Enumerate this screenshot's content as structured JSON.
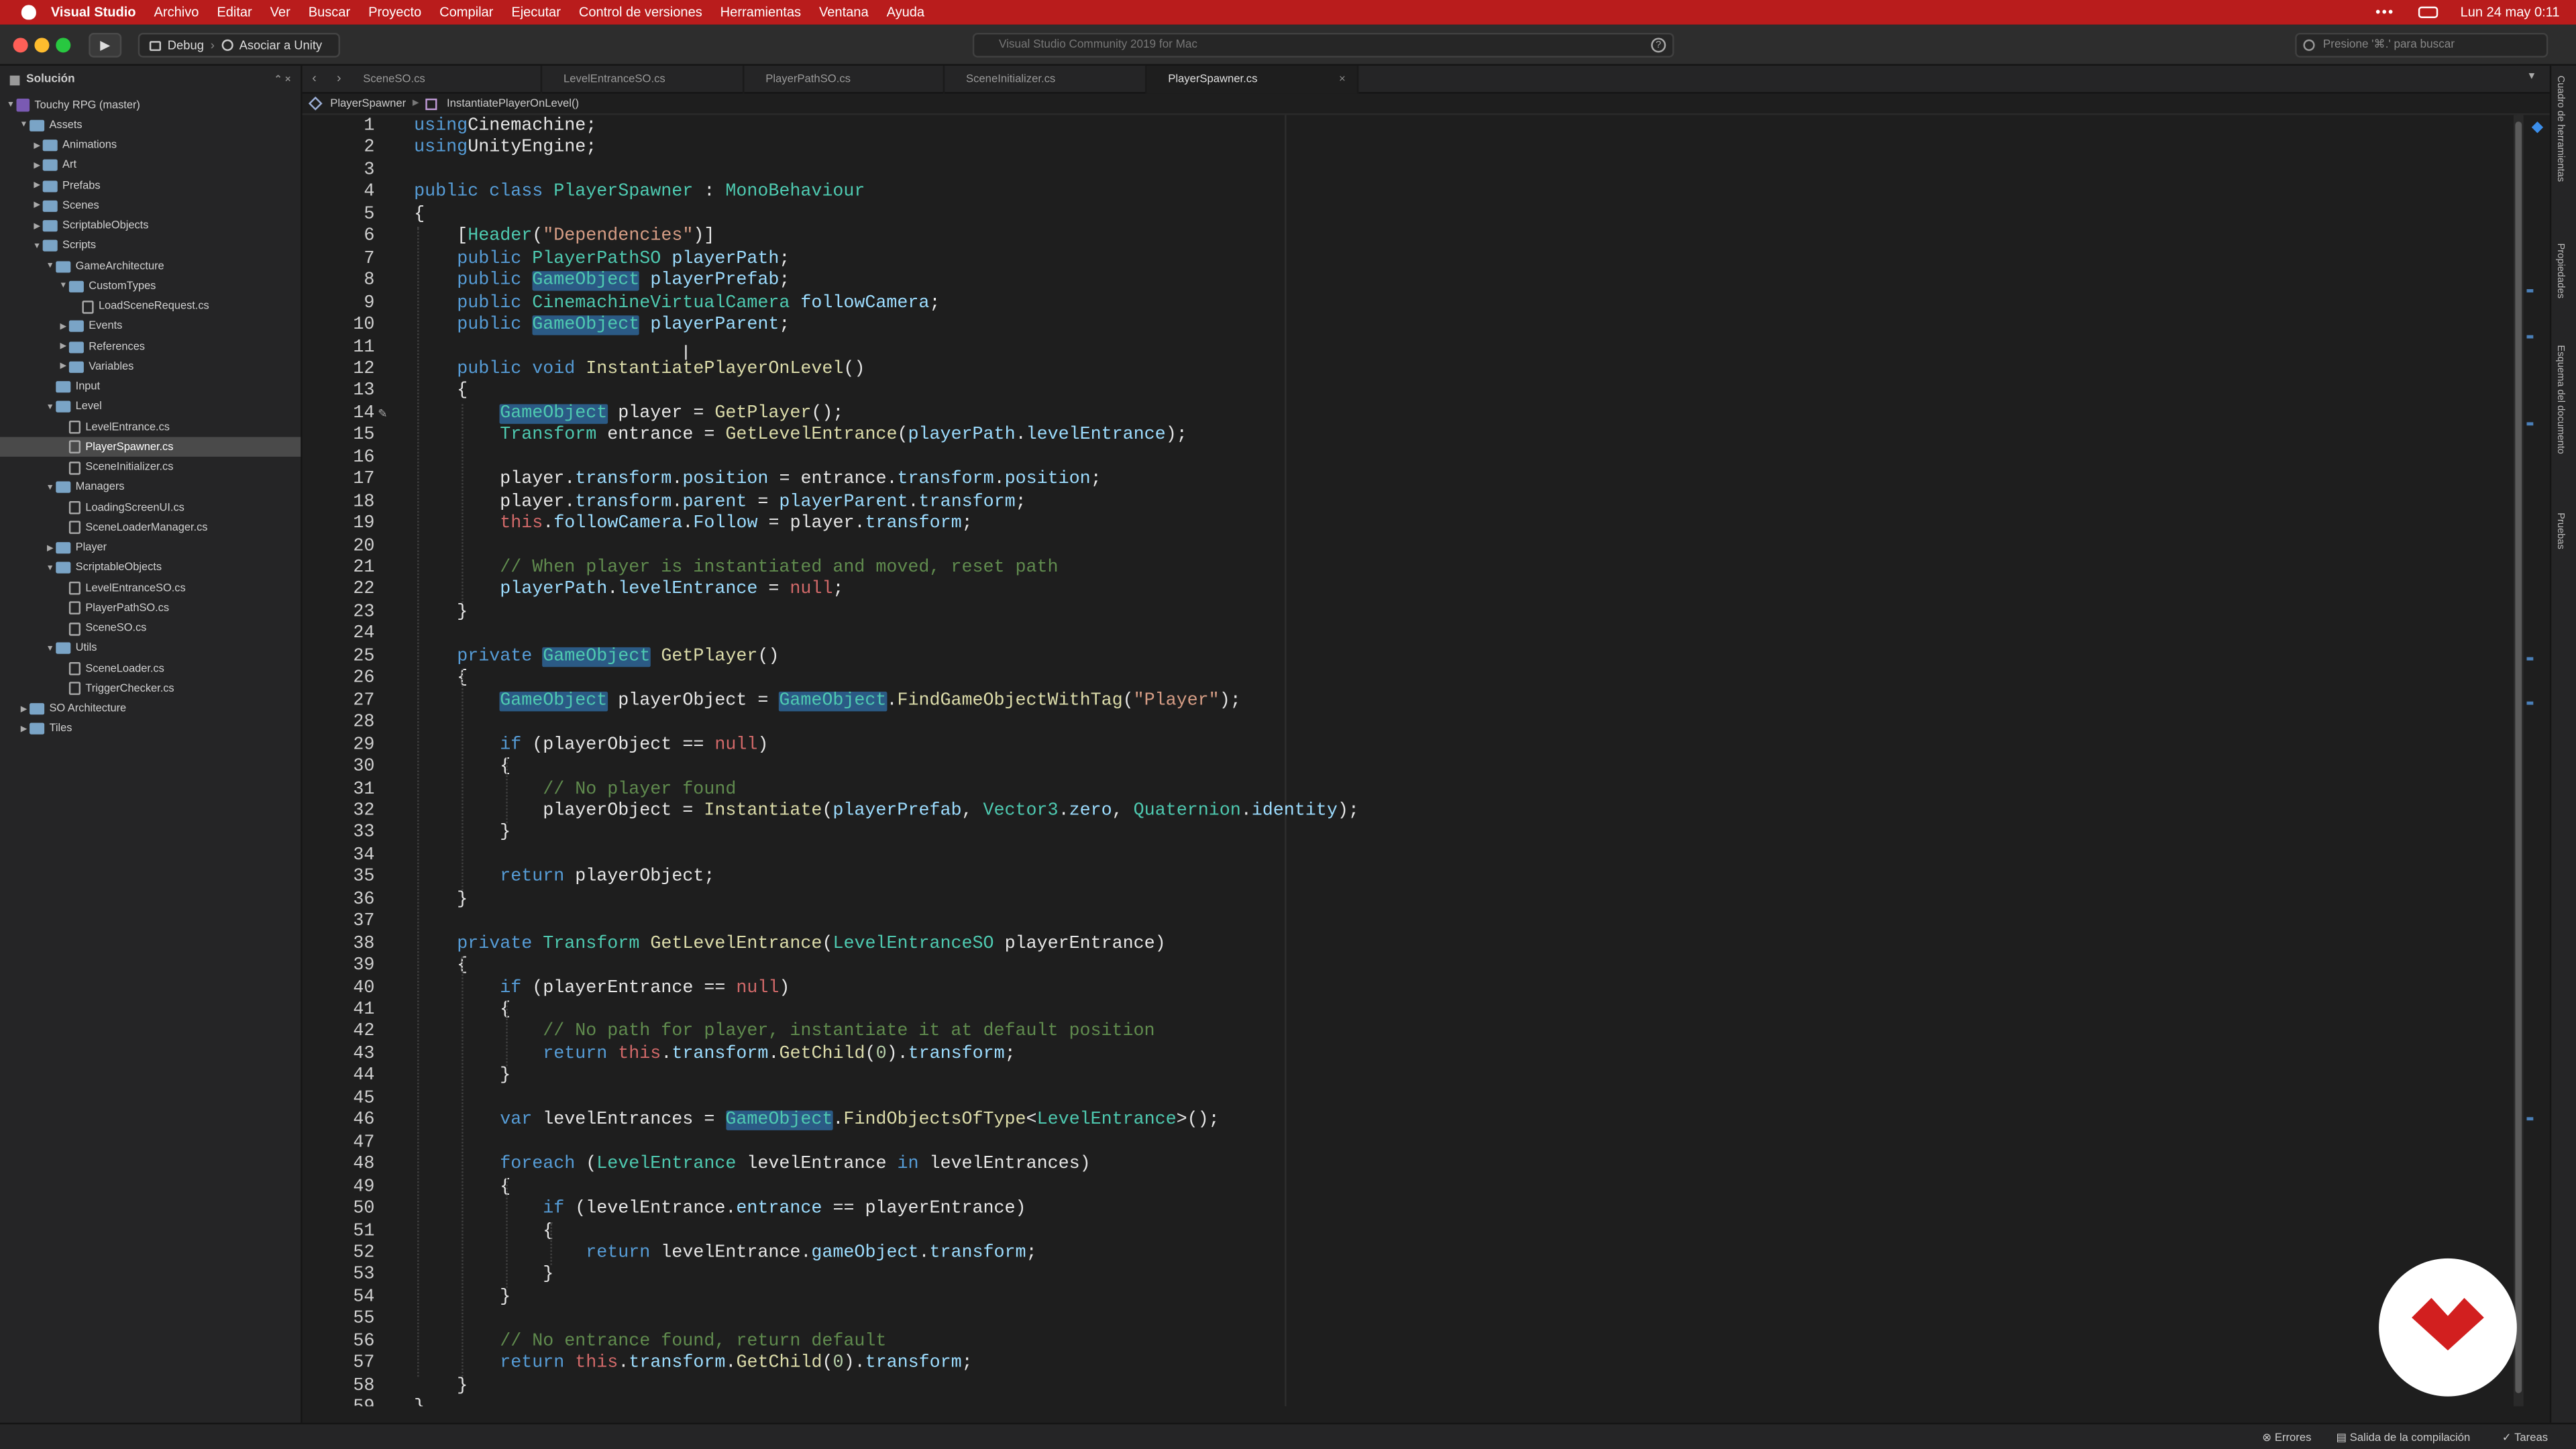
{
  "menubar": {
    "app": "Visual Studio",
    "items": [
      "Archivo",
      "Editar",
      "Ver",
      "Buscar",
      "Proyecto",
      "Compilar",
      "Ejecutar",
      "Control de versiones",
      "Herramientas",
      "Ventana",
      "Ayuda"
    ],
    "more": "•••",
    "clock": "Lun 24 may  0:11"
  },
  "toolbar": {
    "config": "Debug",
    "target": "Asociar a Unity",
    "status": "Visual Studio Community 2019 for Mac",
    "search_placeholder": "Presione '⌘.' para buscar"
  },
  "sidebar": {
    "title": "Solución",
    "rows": [
      {
        "label": "Touchy RPG (master)",
        "depth": 0,
        "icon": "sol",
        "open": true
      },
      {
        "label": "Assets",
        "depth": 1,
        "icon": "folder",
        "open": true
      },
      {
        "label": "Animations",
        "depth": 2,
        "icon": "folder",
        "open": false
      },
      {
        "label": "Art",
        "depth": 2,
        "icon": "folder",
        "open": false
      },
      {
        "label": "Prefabs",
        "depth": 2,
        "icon": "folder",
        "open": false
      },
      {
        "label": "Scenes",
        "depth": 2,
        "icon": "folder",
        "open": false
      },
      {
        "label": "ScriptableObjects",
        "depth": 2,
        "icon": "folder",
        "open": false
      },
      {
        "label": "Scripts",
        "depth": 2,
        "icon": "folder",
        "open": true
      },
      {
        "label": "GameArchitecture",
        "depth": 3,
        "icon": "folder",
        "open": true
      },
      {
        "label": "CustomTypes",
        "depth": 4,
        "icon": "folder",
        "open": true
      },
      {
        "label": "LoadSceneRequest.cs",
        "depth": 5,
        "icon": "file"
      },
      {
        "label": "Events",
        "depth": 4,
        "icon": "folder",
        "open": false
      },
      {
        "label": "References",
        "depth": 4,
        "icon": "folder",
        "open": false
      },
      {
        "label": "Variables",
        "depth": 4,
        "icon": "folder",
        "open": false
      },
      {
        "label": "Input",
        "depth": 3,
        "icon": "folder"
      },
      {
        "label": "Level",
        "depth": 3,
        "icon": "folder",
        "open": true
      },
      {
        "label": "LevelEntrance.cs",
        "depth": 4,
        "icon": "file"
      },
      {
        "label": "PlayerSpawner.cs",
        "depth": 4,
        "icon": "file",
        "selected": true
      },
      {
        "label": "SceneInitializer.cs",
        "depth": 4,
        "icon": "file"
      },
      {
        "label": "Managers",
        "depth": 3,
        "icon": "folder",
        "open": true
      },
      {
        "label": "LoadingScreenUI.cs",
        "depth": 4,
        "icon": "file"
      },
      {
        "label": "SceneLoaderManager.cs",
        "depth": 4,
        "icon": "file"
      },
      {
        "label": "Player",
        "depth": 3,
        "icon": "folder",
        "open": false
      },
      {
        "label": "ScriptableObjects",
        "depth": 3,
        "icon": "folder",
        "open": true
      },
      {
        "label": "LevelEntranceSO.cs",
        "depth": 4,
        "icon": "file"
      },
      {
        "label": "PlayerPathSO.cs",
        "depth": 4,
        "icon": "file"
      },
      {
        "label": "SceneSO.cs",
        "depth": 4,
        "icon": "file"
      },
      {
        "label": "Utils",
        "depth": 3,
        "icon": "folder",
        "open": true
      },
      {
        "label": "SceneLoader.cs",
        "depth": 4,
        "icon": "file"
      },
      {
        "label": "TriggerChecker.cs",
        "depth": 4,
        "icon": "file"
      },
      {
        "label": "SO Architecture",
        "depth": 1,
        "icon": "folder",
        "open": false
      },
      {
        "label": "Tiles",
        "depth": 1,
        "icon": "folder",
        "open": false
      }
    ]
  },
  "tabs": [
    "SceneSO.cs",
    "LevelEntranceSO.cs",
    "PlayerPathSO.cs",
    "SceneInitializer.cs",
    "PlayerSpawner.cs"
  ],
  "active_tab": 4,
  "breadcrumb": {
    "class": "PlayerSpawner",
    "method": "InstantiatePlayerOnLevel()"
  },
  "code": [
    [
      [
        "k",
        "using"
      ],
      [
        "",
        "Cinemachine;"
      ]
    ],
    [
      [
        "k",
        "using"
      ],
      [
        "",
        "UnityEngine;"
      ]
    ],
    [],
    [
      [
        "k",
        "public class "
      ],
      [
        "t",
        "PlayerSpawner"
      ],
      [
        "",
        " : "
      ],
      [
        "t",
        "MonoBehaviour"
      ]
    ],
    [
      [
        "",
        "{"
      ]
    ],
    [
      [
        "",
        "    ["
      ],
      [
        "t",
        "Header"
      ],
      [
        "",
        "("
      ],
      [
        "s",
        "\"Dependencies\""
      ],
      [
        "",
        ")]"
      ]
    ],
    [
      [
        "",
        "    "
      ],
      [
        "k",
        "public "
      ],
      [
        "t",
        "PlayerPathSO "
      ],
      [
        "p",
        "playerPath"
      ],
      [
        "",
        ";"
      ]
    ],
    [
      [
        "",
        "    "
      ],
      [
        "k",
        "public "
      ],
      [
        "hl",
        "GameObject"
      ],
      [
        "",
        " "
      ],
      [
        "p",
        "playerPrefab"
      ],
      [
        "",
        ";"
      ]
    ],
    [
      [
        "",
        "    "
      ],
      [
        "k",
        "public "
      ],
      [
        "t",
        "CinemachineVirtualCamera "
      ],
      [
        "p",
        "followCamera"
      ],
      [
        "",
        ";"
      ]
    ],
    [
      [
        "",
        "    "
      ],
      [
        "k",
        "public "
      ],
      [
        "hl",
        "GameObject"
      ],
      [
        "",
        " "
      ],
      [
        "p",
        "playerParent"
      ],
      [
        "",
        ";"
      ]
    ],
    [],
    [
      [
        "",
        "    "
      ],
      [
        "k",
        "public void "
      ],
      [
        "m",
        "InstantiatePlayerOnLevel"
      ],
      [
        "",
        "()"
      ]
    ],
    [
      [
        "",
        "    {"
      ]
    ],
    [
      [
        "",
        "        "
      ],
      [
        "hl",
        "GameObject"
      ],
      [
        "",
        " player = "
      ],
      [
        "m",
        "GetPlayer"
      ],
      [
        "",
        "();"
      ]
    ],
    [
      [
        "",
        "        "
      ],
      [
        "t",
        "Transform"
      ],
      [
        "",
        " entrance = "
      ],
      [
        "m",
        "GetLevelEntrance"
      ],
      [
        "",
        "("
      ],
      [
        "p",
        "playerPath"
      ],
      [
        "",
        "."
      ],
      [
        "p",
        "levelEntrance"
      ],
      [
        "",
        ");"
      ]
    ],
    [],
    [
      [
        "",
        "        player."
      ],
      [
        "p",
        "transform"
      ],
      [
        "",
        "."
      ],
      [
        "p",
        "position"
      ],
      [
        "",
        " = entrance."
      ],
      [
        "p",
        "transform"
      ],
      [
        "",
        "."
      ],
      [
        "p",
        "position"
      ],
      [
        "",
        ";"
      ]
    ],
    [
      [
        "",
        "        player."
      ],
      [
        "p",
        "transform"
      ],
      [
        "",
        "."
      ],
      [
        "p",
        "parent"
      ],
      [
        "",
        " = "
      ],
      [
        "p",
        "playerParent"
      ],
      [
        "",
        "."
      ],
      [
        "p",
        "transform"
      ],
      [
        "",
        ";"
      ]
    ],
    [
      [
        "",
        "        "
      ],
      [
        "th",
        "this"
      ],
      [
        "",
        "."
      ],
      [
        "p",
        "followCamera"
      ],
      [
        "",
        "."
      ],
      [
        "p",
        "Follow"
      ],
      [
        "",
        " = player."
      ],
      [
        "p",
        "transform"
      ],
      [
        "",
        ";"
      ]
    ],
    [],
    [
      [
        "",
        "        "
      ],
      [
        "c",
        "// When player is instantiated and moved, reset path"
      ]
    ],
    [
      [
        "",
        "        "
      ],
      [
        "p",
        "playerPath"
      ],
      [
        "",
        "."
      ],
      [
        "p",
        "levelEntrance"
      ],
      [
        "",
        " = "
      ],
      [
        "th",
        "null"
      ],
      [
        "",
        ";"
      ]
    ],
    [
      [
        "",
        "    }"
      ]
    ],
    [],
    [
      [
        "",
        "    "
      ],
      [
        "k",
        "private "
      ],
      [
        "hl",
        "GameObject"
      ],
      [
        "",
        " "
      ],
      [
        "m",
        "GetPlayer"
      ],
      [
        "",
        "()"
      ]
    ],
    [
      [
        "",
        "    {"
      ]
    ],
    [
      [
        "",
        "        "
      ],
      [
        "hl",
        "GameObject"
      ],
      [
        "",
        " playerObject = "
      ],
      [
        "hl",
        "GameObject"
      ],
      [
        "",
        "."
      ],
      [
        "m",
        "FindGameObjectWithTag"
      ],
      [
        "",
        "("
      ],
      [
        "s",
        "\"Player\""
      ],
      [
        "",
        ");"
      ]
    ],
    [],
    [
      [
        "",
        "        "
      ],
      [
        "k",
        "if"
      ],
      [
        "",
        " (playerObject == "
      ],
      [
        "th",
        "null"
      ],
      [
        "",
        ")"
      ]
    ],
    [
      [
        "",
        "        {"
      ]
    ],
    [
      [
        "",
        "            "
      ],
      [
        "c",
        "// No player found"
      ]
    ],
    [
      [
        "",
        "            playerObject = "
      ],
      [
        "m",
        "Instantiate"
      ],
      [
        "",
        "("
      ],
      [
        "p",
        "playerPrefab"
      ],
      [
        "",
        ", "
      ],
      [
        "t",
        "Vector3"
      ],
      [
        "",
        "."
      ],
      [
        "p",
        "zero"
      ],
      [
        "",
        ", "
      ],
      [
        "t",
        "Quaternion"
      ],
      [
        "",
        "."
      ],
      [
        "p",
        "identity"
      ],
      [
        "",
        ");"
      ]
    ],
    [
      [
        "",
        "        }"
      ]
    ],
    [],
    [
      [
        "",
        "        "
      ],
      [
        "k",
        "return"
      ],
      [
        "",
        " playerObject;"
      ]
    ],
    [
      [
        "",
        "    }"
      ]
    ],
    [],
    [
      [
        "",
        "    "
      ],
      [
        "k",
        "private "
      ],
      [
        "t",
        "Transform "
      ],
      [
        "m",
        "GetLevelEntrance"
      ],
      [
        "",
        "("
      ],
      [
        "t",
        "LevelEntranceSO"
      ],
      [
        "",
        " playerEntrance)"
      ]
    ],
    [
      [
        "",
        "    {"
      ]
    ],
    [
      [
        "",
        "        "
      ],
      [
        "k",
        "if"
      ],
      [
        "",
        " (playerEntrance == "
      ],
      [
        "th",
        "null"
      ],
      [
        "",
        ")"
      ]
    ],
    [
      [
        "",
        "        {"
      ]
    ],
    [
      [
        "",
        "            "
      ],
      [
        "c",
        "// No path for player, instantiate it at default position"
      ]
    ],
    [
      [
        "",
        "            "
      ],
      [
        "k",
        "return "
      ],
      [
        "th",
        "this"
      ],
      [
        "",
        "."
      ],
      [
        "p",
        "transform"
      ],
      [
        "",
        "."
      ],
      [
        "m",
        "GetChild"
      ],
      [
        "",
        "("
      ],
      [
        "n",
        "0"
      ],
      [
        "",
        ")."
      ],
      [
        "p",
        "transform"
      ],
      [
        "",
        ";"
      ]
    ],
    [
      [
        "",
        "        }"
      ]
    ],
    [],
    [
      [
        "",
        "        "
      ],
      [
        "k",
        "var"
      ],
      [
        "",
        " levelEntrances = "
      ],
      [
        "hl",
        "GameObject"
      ],
      [
        "",
        "."
      ],
      [
        "m",
        "FindObjectsOfType"
      ],
      [
        "",
        "<"
      ],
      [
        "t",
        "LevelEntrance"
      ],
      [
        "",
        ">();"
      ]
    ],
    [],
    [
      [
        "",
        "        "
      ],
      [
        "k",
        "foreach"
      ],
      [
        "",
        " ("
      ],
      [
        "t",
        "LevelEntrance"
      ],
      [
        "",
        " levelEntrance "
      ],
      [
        "k",
        "in"
      ],
      [
        "",
        " levelEntrances)"
      ]
    ],
    [
      [
        "",
        "        {"
      ]
    ],
    [
      [
        "",
        "            "
      ],
      [
        "k",
        "if"
      ],
      [
        "",
        " (levelEntrance."
      ],
      [
        "p",
        "entrance"
      ],
      [
        "",
        " == playerEntrance)"
      ]
    ],
    [
      [
        "",
        "            {"
      ]
    ],
    [
      [
        "",
        "                "
      ],
      [
        "k",
        "return"
      ],
      [
        "",
        " levelEntrance."
      ],
      [
        "p",
        "gameObject"
      ],
      [
        "",
        "."
      ],
      [
        "p",
        "transform"
      ],
      [
        "",
        ";"
      ]
    ],
    [
      [
        "",
        "            }"
      ]
    ],
    [
      [
        "",
        "        }"
      ]
    ],
    [],
    [
      [
        "",
        "        "
      ],
      [
        "c",
        "// No entrance found, return default"
      ]
    ],
    [
      [
        "",
        "        "
      ],
      [
        "k",
        "return "
      ],
      [
        "th",
        "this"
      ],
      [
        "",
        "."
      ],
      [
        "p",
        "transform"
      ],
      [
        "",
        "."
      ],
      [
        "m",
        "GetChild"
      ],
      [
        "",
        "("
      ],
      [
        "n",
        "0"
      ],
      [
        "",
        ")."
      ],
      [
        "p",
        "transform"
      ],
      [
        "",
        ";"
      ]
    ],
    [
      [
        "",
        "    }"
      ]
    ],
    [
      [
        "",
        "}"
      ]
    ]
  ],
  "right_dock": [
    "Cuadro de herramientas",
    "Propiedades",
    "Esquema del documento",
    "Pruebas"
  ],
  "statusbar": {
    "errors": "Errores",
    "build_output": "Salida de la compilación",
    "tasks": "Tareas"
  },
  "colors": {
    "menubar": "#b91c1c",
    "editor_bg": "#1e1e1e",
    "sidebar_bg": "#252526",
    "logo_red": "#d21f1f",
    "selection": "#4a4a4a"
  }
}
